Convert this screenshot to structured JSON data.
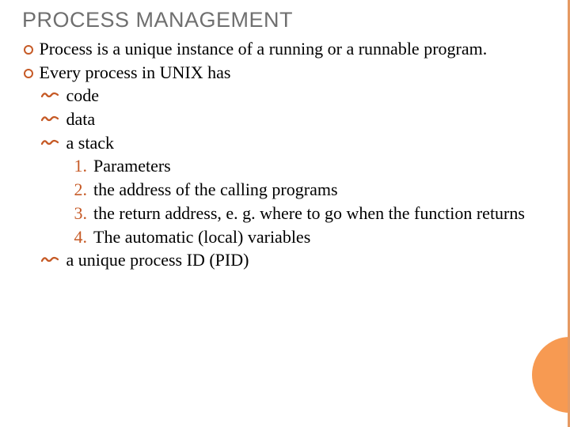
{
  "title": "PROCESS MANAGEMENT",
  "b1": "Process is a unique instance of a running or a runnable program.",
  "b2": "Every process in UNIX has",
  "s1": "code",
  "s2": "data",
  "s3": "a stack",
  "n1": "1.",
  "n1t": "Parameters",
  "n2": "2.",
  "n2t": "the address of the calling programs",
  "n3": "3.",
  "n3t": "the return address, e. g. where to go when the function returns",
  "n4": "4.",
  "n4t": "The automatic (local) variables",
  "s4": "a unique process ID (PID)"
}
